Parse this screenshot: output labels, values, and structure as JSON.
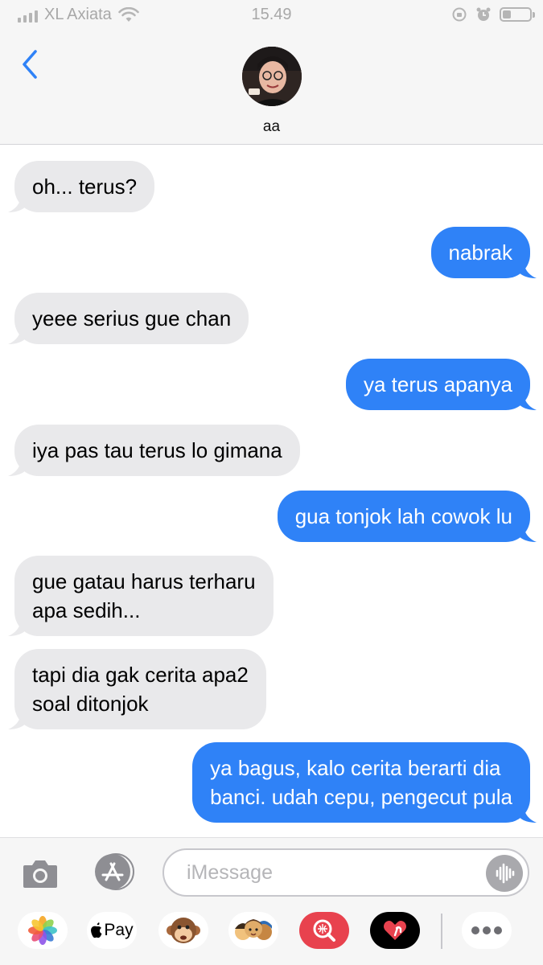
{
  "status_bar": {
    "carrier": "XL Axiata",
    "time": "15.49"
  },
  "header": {
    "contact_name": "aa"
  },
  "messages": [
    {
      "direction": "incoming",
      "lines": [
        "oh... terus?"
      ]
    },
    {
      "direction": "outgoing",
      "lines": [
        "nabrak"
      ]
    },
    {
      "direction": "incoming",
      "lines": [
        "yeee serius gue chan"
      ]
    },
    {
      "direction": "outgoing",
      "lines": [
        "ya terus apanya"
      ]
    },
    {
      "direction": "incoming",
      "lines": [
        "iya pas tau terus lo gimana"
      ]
    },
    {
      "direction": "outgoing",
      "lines": [
        "gua tonjok lah cowok lu"
      ]
    },
    {
      "direction": "incoming",
      "lines": [
        "gue gatau harus terharu",
        "apa sedih..."
      ]
    },
    {
      "direction": "incoming",
      "lines": [
        "tapi dia gak cerita apa2",
        "soal ditonjok"
      ]
    },
    {
      "direction": "outgoing",
      "lines": [
        "ya bagus, kalo cerita berarti dia",
        "banci. udah cepu, pengecut pula"
      ]
    }
  ],
  "input": {
    "placeholder": "iMessage"
  },
  "app_drawer": {
    "apple_pay_label": "Pay",
    "icons": [
      "photos-icon",
      "apple-pay-icon",
      "animoji-icon",
      "memoji-icon",
      "web-search-icon",
      "digital-touch-icon",
      "more-icon"
    ]
  },
  "colors": {
    "outgoing_bubble": "#2f82f7",
    "incoming_bubble": "#e9e9eb",
    "accent": "#2f82f7"
  }
}
